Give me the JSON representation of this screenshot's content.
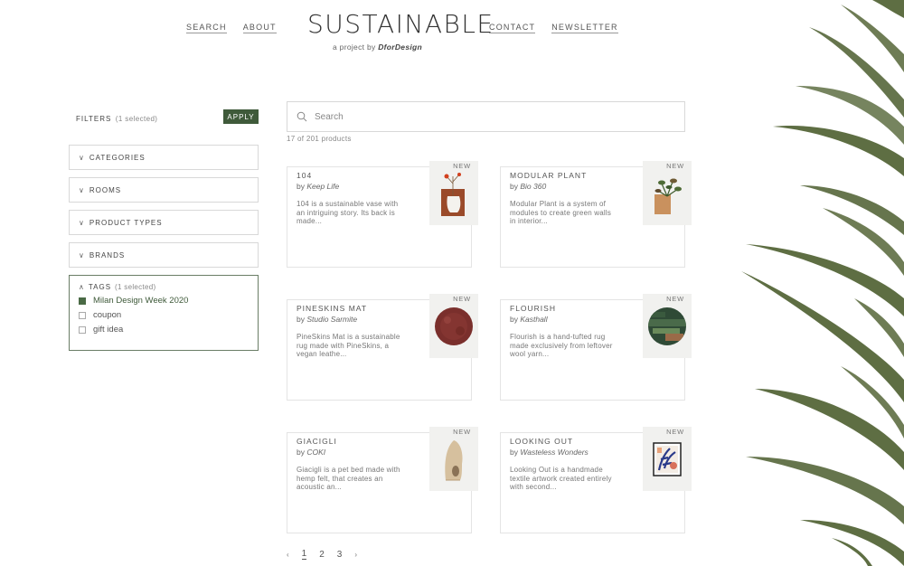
{
  "header": {
    "nav_left": [
      "SEARCH",
      "ABOUT"
    ],
    "nav_right": [
      "CONTACT",
      "NEWSLETTER"
    ],
    "logo_text": "SUSTAINABLE",
    "tagline_prefix": "a project by ",
    "tagline_brand": "DforDesign"
  },
  "filters": {
    "label": "FILTERS",
    "selected": "(1 selected)",
    "apply": "APPLY",
    "sections": [
      "CATEGORIES",
      "ROOMS",
      "PRODUCT TYPES",
      "BRANDS"
    ],
    "tags": {
      "title": "TAGS",
      "selected": "(1 selected)",
      "items": [
        {
          "label": "Milan Design Week 2020",
          "checked": true
        },
        {
          "label": "coupon",
          "checked": false
        },
        {
          "label": "gift idea",
          "checked": false
        }
      ]
    }
  },
  "search": {
    "placeholder": "Search",
    "result_count": "17 of 201 products"
  },
  "products": [
    {
      "title": "104",
      "by": "by ",
      "brand": "Keep Life",
      "desc": "104 is a sustainable vase with an intriguing story. Its back is made...",
      "badge": "NEW",
      "image": "vase"
    },
    {
      "title": "MODULAR PLANT",
      "by": "by ",
      "brand": "Bio 360",
      "desc": "Modular Plant is a system of modules to create green walls in interior...",
      "badge": "NEW",
      "image": "plant"
    },
    {
      "title": "PINESKINS MAT",
      "by": "by ",
      "brand": "Studio Sarmite",
      "desc": "PineSkins Mat is a sustainable rug made with PineSkins, a vegan leathe...",
      "badge": "NEW",
      "image": "rug-red"
    },
    {
      "title": "FLOURISH",
      "by": "by ",
      "brand": "Kasthall",
      "desc": "Flourish is a hand-tufted rug made exclusively from leftover wool yarn...",
      "badge": "NEW",
      "image": "rug-green"
    },
    {
      "title": "GIACIGLI",
      "by": "by ",
      "brand": "COKI",
      "desc": "Giacigli is a pet bed made with hemp felt, that creates an acoustic an...",
      "badge": "NEW",
      "image": "pet-bed"
    },
    {
      "title": "LOOKING OUT",
      "by": "by ",
      "brand": "Wasteless Wonders",
      "desc": "Looking Out is a handmade textile artwork created entirely with second...",
      "badge": "NEW",
      "image": "artwork"
    }
  ],
  "pagination": {
    "prev": "‹",
    "pages": [
      "1",
      "2",
      "3"
    ],
    "current": "1",
    "next": "›"
  },
  "colors": {
    "accent": "#3f5a3a",
    "leaf": "#5e6e43"
  }
}
